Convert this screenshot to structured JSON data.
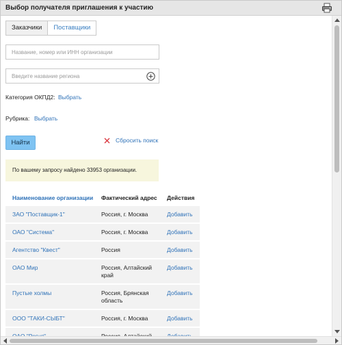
{
  "dialog": {
    "title": "Выбор получателя приглашения к участию",
    "print_icon": "printer-icon"
  },
  "tabs": [
    {
      "label": "Заказчики",
      "active": true
    },
    {
      "label": "Поставщики",
      "active": false
    }
  ],
  "search": {
    "org_placeholder": "Название, номер или ИНН организации",
    "org_value": "",
    "region_placeholder": "Введите название региона",
    "region_value": "",
    "region_add_icon": "plus-circle-icon"
  },
  "filters": {
    "okpd_label": "Категория ОКПД2:",
    "okpd_link": "Выбрать",
    "rubric_label": "Рубрика:",
    "rubric_link": "Выбрать"
  },
  "actions": {
    "find_label": "Найти",
    "reset_label": "Сбросить поиск",
    "reset_icon": "close-x-icon"
  },
  "result_notice": "По вашему запросу найдено 33953 организации.",
  "table": {
    "headers": {
      "name": "Наименование организации",
      "address": "Фактический адрес",
      "actions": "Действия"
    },
    "rows": [
      {
        "name": "ЗАО \"Поставщик-1\"",
        "address": "Россия, г. Москва",
        "action": "Добавить"
      },
      {
        "name": "ОАО \"Система\"",
        "address": "Россия, г. Москва",
        "action": "Добавить"
      },
      {
        "name": "Агентство \"Квест\"",
        "address": "Россия",
        "action": "Добавить"
      },
      {
        "name": "ОАО Мир",
        "address": "Россия, Алтайский край",
        "action": "Добавить"
      },
      {
        "name": "Пустые холмы",
        "address": "Россия, Брянская область",
        "action": "Добавить"
      },
      {
        "name": "ООО \"ТАКИ-СЫБТ\"",
        "address": "Россия, г. Москва",
        "action": "Добавить"
      },
      {
        "name": "ОАО \"Регул\"",
        "address": "Россия, Алтайский",
        "action": "Добавить"
      }
    ]
  },
  "colors": {
    "link": "#2f72b8",
    "button": "#7fc3f2",
    "notice_bg": "#f7f6dd",
    "titlebar_bg": "#e6e6e6",
    "row_bg": "#f2f2f2"
  }
}
